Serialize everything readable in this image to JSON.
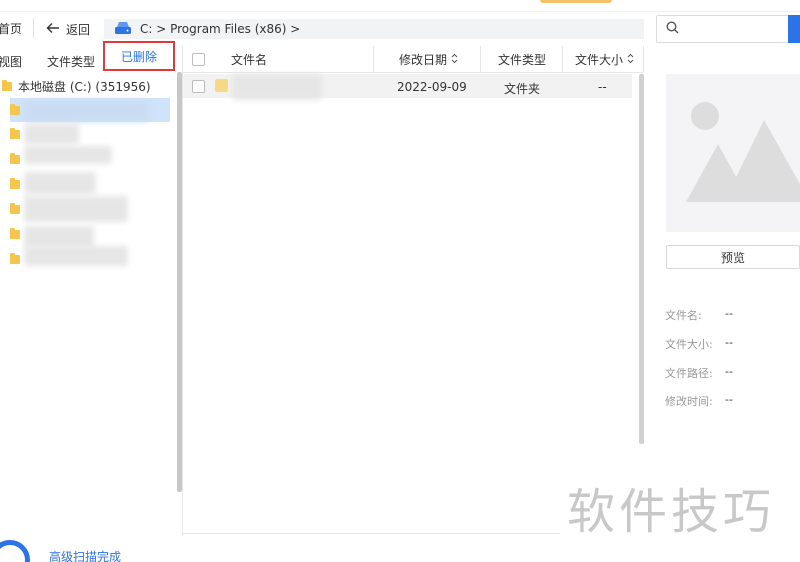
{
  "nav": {
    "home_label": "首页",
    "back_label": "返回",
    "path": "C:  >  Program Files (x86)  >",
    "search_placeholder": ""
  },
  "left_tabs": {
    "view": "视图",
    "file_type": "文件类型",
    "deleted": "已删除"
  },
  "tree": {
    "root_label": "本地磁盘 (C:) (351956)",
    "item_count_visible": 7
  },
  "list": {
    "columns": [
      "文件名",
      "修改日期",
      "文件类型",
      "文件大小"
    ],
    "rows": [
      {
        "name": "",
        "date": "2022-09-09",
        "type": "文件夹",
        "size": "--"
      }
    ]
  },
  "details": {
    "preview_button": "预览",
    "fields": [
      {
        "label": "文件名:",
        "value": "--"
      },
      {
        "label": "文件大小:",
        "value": "--"
      },
      {
        "label": "文件路径:",
        "value": "--"
      },
      {
        "label": "修改时间:",
        "value": "--"
      }
    ]
  },
  "status": {
    "scan_text": "高级扫描完成"
  },
  "watermark": "软件技巧",
  "colors": {
    "accent": "#2b73e6",
    "highlight_box": "#e23a3a",
    "folder": "#f6c64c",
    "selected_row": "#cfe4fb"
  }
}
